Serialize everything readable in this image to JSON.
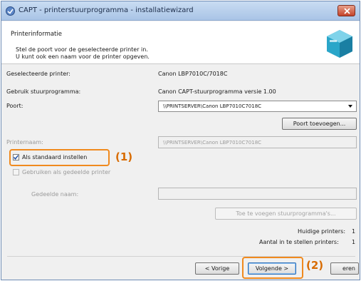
{
  "window": {
    "title": "CAPT - printerstuurprogramma - installatiewizard"
  },
  "header": {
    "title": "Printerinformatie",
    "line1": "Stel de poort voor de geselecteerde printer in.",
    "line2": "U kunt ook een naam voor de printer opgeven."
  },
  "fields": {
    "selected_printer_label": "Geselecteerde printer:",
    "selected_printer_value": "Canon LBP7010C/7018C",
    "driver_label": "Gebruik stuurprogramma:",
    "driver_value": "Canon CAPT-stuurprogramma versie 1.00",
    "port_label": "Poort:",
    "port_value": "\\\\PRINTSERVER\\Canon LBP7010C7018C",
    "add_port_button": "Poort toevoegen...",
    "printer_name_label": "Printernaam:",
    "printer_name_value": "\\\\PRINTSERVER\\Canon LBP7010C7018C",
    "set_default_label": "Als standaard instellen",
    "set_default_checked": true,
    "shared_label": "Gebruiken als gedeelde printer",
    "shared_checked": false,
    "shared_name_label": "Gedeelde naam:",
    "add_drivers_button": "Toe te voegen stuurprogramma's...",
    "current_printers_label": "Huidige printers:",
    "current_printers_value": "1",
    "printers_to_set_label": "Aantal in te stellen printers:",
    "printers_to_set_value": "1"
  },
  "buttons": {
    "back": "< Vorige",
    "next": "Volgende >",
    "cancel": "eren"
  },
  "callouts": {
    "one": "(1)",
    "two": "(2)"
  },
  "colors": {
    "highlight": "#f08a1e",
    "callout_text": "#d86b00",
    "titlebar": "#b9d0ee",
    "close_button": "#c4432a"
  }
}
